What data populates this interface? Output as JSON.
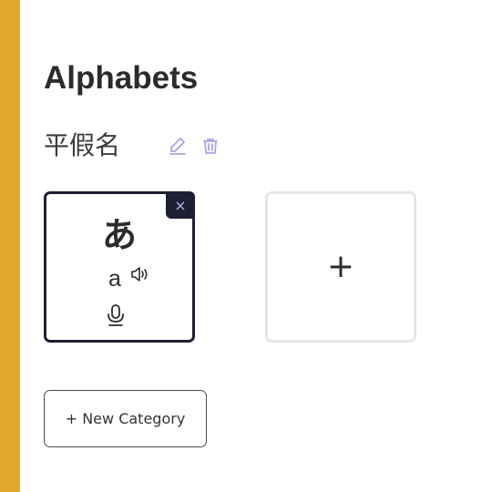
{
  "page": {
    "title": "Alphabets"
  },
  "category": {
    "name": "平假名",
    "edit_icon": "edit-pencil-icon",
    "delete_icon": "trash-icon"
  },
  "cards": [
    {
      "glyph": "あ",
      "romaji": "a",
      "remove_label": "×",
      "speaker_icon": "speaker-icon",
      "mic_icon": "microphone-icon"
    }
  ],
  "add_card": {
    "label": "+"
  },
  "new_category_button": {
    "label": "+ New Category"
  },
  "colors": {
    "accent_bar": "#e2a82e",
    "card_border": "#1d1f33",
    "icon_tint": "#a9a4e8"
  }
}
